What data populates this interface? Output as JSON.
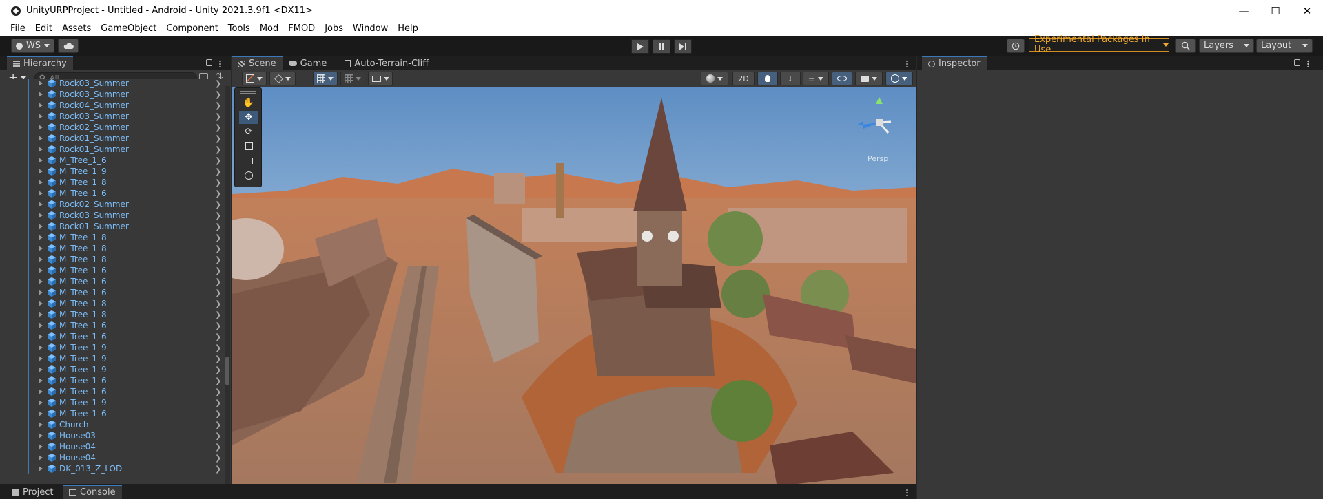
{
  "window": {
    "title": "UnityURPProject - Untitled - Android - Unity 2021.3.9f1 <DX11>"
  },
  "menu": [
    "File",
    "Edit",
    "Assets",
    "GameObject",
    "Component",
    "Tools",
    "Mod",
    "FMOD",
    "Jobs",
    "Window",
    "Help"
  ],
  "toolbar": {
    "account": "WS",
    "experimental": "Experimental Packages In Use",
    "layers": "Layers",
    "layout": "Layout"
  },
  "hierarchy": {
    "title": "Hierarchy",
    "search_placeholder": "All",
    "items": [
      "Rock03_Summer",
      "Rock03_Summer",
      "Rock04_Summer",
      "Rock03_Summer",
      "Rock02_Summer",
      "Rock01_Summer",
      "Rock01_Summer",
      "M_Tree_1_6",
      "M_Tree_1_9",
      "M_Tree_1_8",
      "M_Tree_1_6",
      "Rock02_Summer",
      "Rock03_Summer",
      "Rock01_Summer",
      "M_Tree_1_8",
      "M_Tree_1_8",
      "M_Tree_1_8",
      "M_Tree_1_6",
      "M_Tree_1_6",
      "M_Tree_1_6",
      "M_Tree_1_8",
      "M_Tree_1_8",
      "M_Tree_1_6",
      "M_Tree_1_6",
      "M_Tree_1_9",
      "M_Tree_1_9",
      "M_Tree_1_9",
      "M_Tree_1_6",
      "M_Tree_1_6",
      "M_Tree_1_9",
      "M_Tree_1_6",
      "Church",
      "House03",
      "House04",
      "House04",
      "DK_013_Z_LOD"
    ]
  },
  "scene": {
    "tabs": [
      "Scene",
      "Game",
      "Auto-Terrain-Cliff"
    ],
    "mode_2d": "2D",
    "gizmo_label": "Persp"
  },
  "inspector": {
    "title": "Inspector"
  },
  "bottom_tabs": [
    "Project",
    "Console"
  ],
  "colors": {
    "accent": "#3a79bb",
    "warning": "#f0a830",
    "hierarchy_text": "#7dbdf7"
  }
}
